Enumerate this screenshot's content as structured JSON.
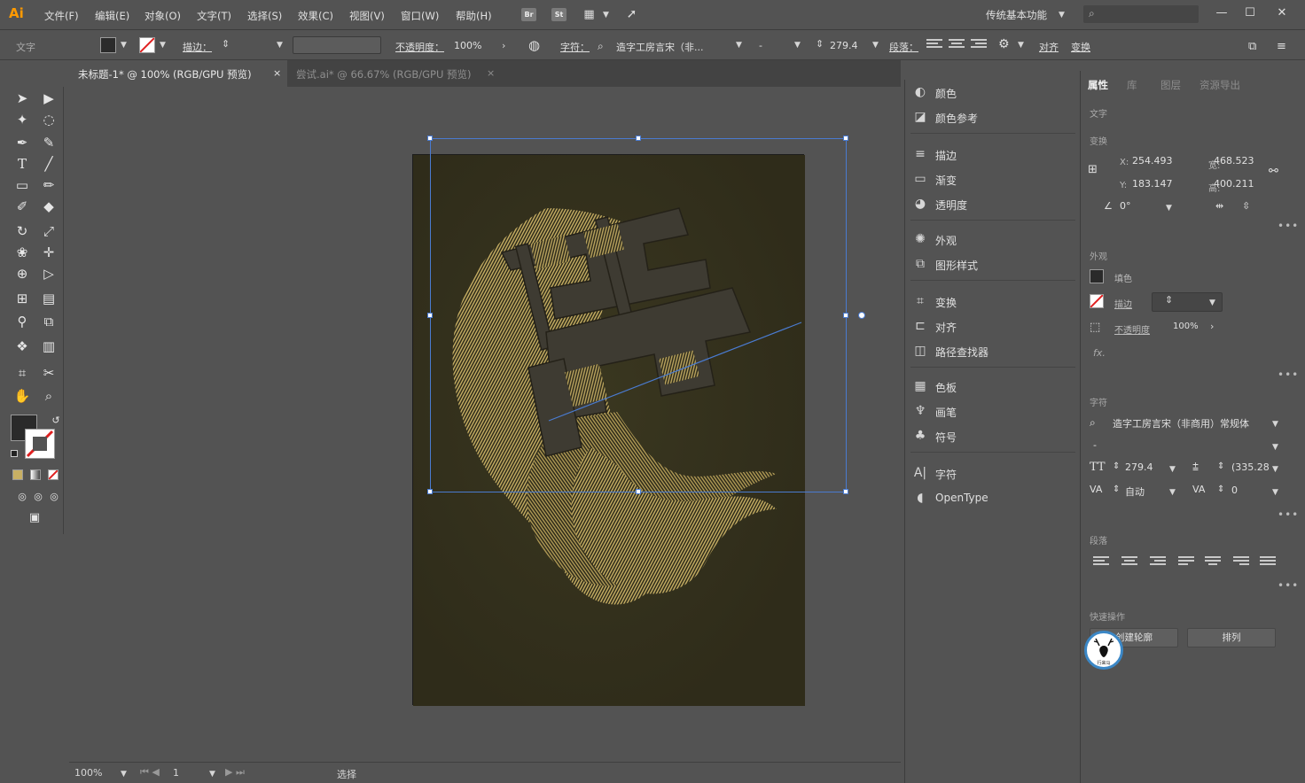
{
  "app": {
    "logo": "Ai",
    "workspace": "传统基本功能"
  },
  "menu": [
    "文件(F)",
    "编辑(E)",
    "对象(O)",
    "文字(T)",
    "选择(S)",
    "效果(C)",
    "视图(V)",
    "窗口(W)",
    "帮助(H)"
  ],
  "menubar_icons": [
    "Br",
    "St"
  ],
  "control": {
    "type_label": "文字",
    "stroke_label": "描边：",
    "opacity_label": "不透明度：",
    "opacity_value": "100%",
    "char_label": "字符：",
    "font_value": "造字工房言宋（非...",
    "style_value": "-",
    "size_value": "279.4",
    "para_label": "段落：",
    "align_label": "对齐",
    "transform_label": "变换"
  },
  "tabs": [
    {
      "label": "未标题-1* @ 100% (RGB/GPU 预览)",
      "active": true
    },
    {
      "label": "尝试.ai* @ 66.67% (RGB/GPU 预览)",
      "active": false
    }
  ],
  "colors": {
    "artboard_bg": "#2f2c1a",
    "art_gold": "#c8b064",
    "art_face": "#3e3b32",
    "selection_blue": "#4a7bd0",
    "logo_orange": "#ff9a00",
    "avatar_ring": "#3b87c6"
  },
  "status": {
    "zoom": "100%",
    "page": "1",
    "tool": "选择"
  },
  "panels_dock": [
    {
      "label": "颜色",
      "icon": "color-icon"
    },
    {
      "label": "颜色参考",
      "icon": "color-guide-icon"
    },
    {
      "label": "描边",
      "icon": "stroke-icon"
    },
    {
      "label": "渐变",
      "icon": "gradient-icon"
    },
    {
      "label": "透明度",
      "icon": "transparency-icon"
    },
    {
      "label": "外观",
      "icon": "appearance-icon"
    },
    {
      "label": "图形样式",
      "icon": "graphic-styles-icon"
    },
    {
      "label": "变换",
      "icon": "transform-icon"
    },
    {
      "label": "对齐",
      "icon": "align-icon"
    },
    {
      "label": "路径查找器",
      "icon": "pathfinder-icon"
    },
    {
      "label": "色板",
      "icon": "swatches-icon"
    },
    {
      "label": "画笔",
      "icon": "brushes-icon"
    },
    {
      "label": "符号",
      "icon": "symbols-icon"
    },
    {
      "label": "字符",
      "icon": "character-icon"
    },
    {
      "label": "OpenType",
      "icon": "opentype-icon"
    }
  ],
  "properties": {
    "tabs": [
      "属性",
      "库",
      "图层",
      "资源导出"
    ],
    "section_type": "文字",
    "section_transform": "变换",
    "x_label": "X:",
    "x_value": "254.493",
    "y_label": "Y:",
    "y_value": "183.147",
    "w_label": "宽:",
    "w_value": "468.523",
    "h_label": "高:",
    "h_value": "400.211",
    "angle_value": "0°",
    "section_appearance": "外观",
    "fill_label": "填色",
    "stroke_label": "描边",
    "opacity_label": "不透明度",
    "opacity_value": "100%",
    "fx_label": "fx.",
    "section_character": "字符",
    "font_value": "造字工房言宋（非商用）常规体",
    "style_value": "-",
    "size_value": "279.4",
    "leading_value": "(335.28",
    "kerning_value": "自动",
    "tracking_value": "0",
    "section_paragraph": "段落",
    "section_quick": "快速操作",
    "qa_outline": "创建轮廓",
    "qa_arrange": "排列"
  },
  "watermark": {
    "text": "行来马"
  }
}
